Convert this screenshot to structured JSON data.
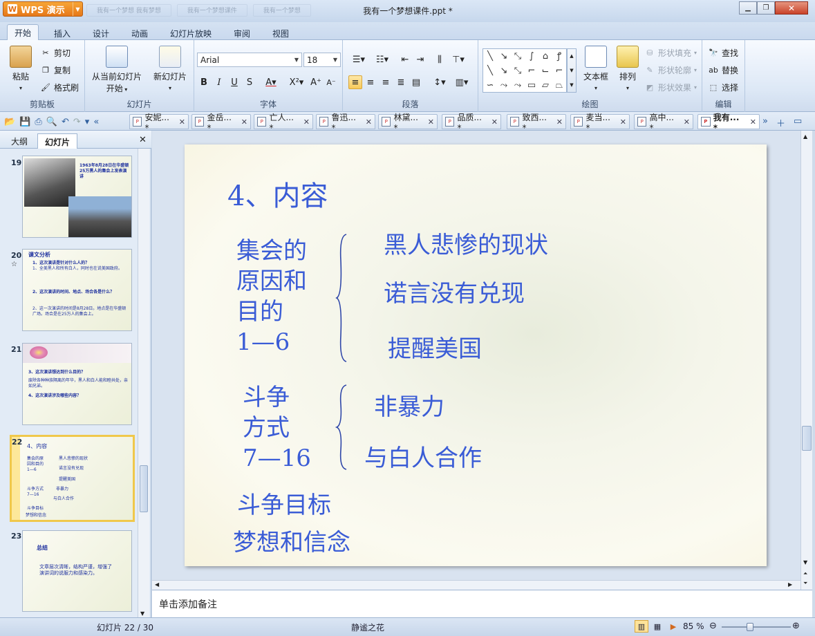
{
  "app": {
    "name": "WPS 演示",
    "window_title": "我有一个梦想课件.ppt *",
    "ghost_tabs": [
      "我有一个梦想 我有梦想",
      "我有一个梦想课件",
      "我有一个梦想"
    ]
  },
  "menu_tabs": [
    "开始",
    "插入",
    "设计",
    "动画",
    "幻灯片放映",
    "审阅",
    "视图"
  ],
  "ribbon": {
    "clipboard": {
      "paste": "粘贴",
      "cut": "剪切",
      "copy": "复制",
      "format_painter": "格式刷",
      "group": "剪贴板"
    },
    "slides": {
      "from_current": "从当前幻灯片",
      "from_current_2": "开始",
      "new_slide": "新幻灯片",
      "group": "幻灯片"
    },
    "font": {
      "name": "Arial",
      "size": "18",
      "group": "字体"
    },
    "paragraph": {
      "group": "段落"
    },
    "drawing": {
      "textbox": "文本框",
      "arrange": "排列",
      "fill": "形状填充",
      "outline": "形状轮廓",
      "effect": "形状效果",
      "group": "绘图"
    },
    "editing": {
      "find": "查找",
      "replace": "替换",
      "select": "选择",
      "group": "编辑"
    }
  },
  "doc_tabs": [
    "安妮... *",
    "金岳... *",
    "亡人... *",
    "鲁迅... *",
    "林黛... *",
    "品质... *",
    "致西... *",
    "麦当... *",
    "高中... *",
    "我有... *"
  ],
  "left_panel": {
    "tabs": [
      "大纲",
      "幻灯片"
    ],
    "slides": [
      {
        "num": "19",
        "lines": [
          "1963年8月28日在华盛",
          "顿25万黑人的集会上",
          "发表演讲"
        ]
      },
      {
        "num": "20",
        "mark": "☆",
        "lines": [
          "课文分析",
          "1、这次演讲是针对什么人的？",
          "1、全美黑人和所有白人，同时也在说美国政府。",
          "2、这次演讲的时间、地点、场合各是什么？",
          "2、这一次演讲的时间是8月28日。地点是在华盛顿广场。场合是在25万人的集会上。"
        ]
      },
      {
        "num": "21",
        "lines": [
          "3、这次演讲想达到什么目的？",
          "废除各种种族隔离的年华，黑人和白人能和睦共处，亲如兄弟。",
          "4、这次演讲涉及哪些内容？"
        ]
      },
      {
        "num": "22",
        "lines": [
          "4、内容",
          "集会的原因和目的1—6",
          "黑人悲惨的现状",
          "诺言没有兑现",
          "提醒美国",
          "斗争方式7—16",
          "非暴力",
          "与白人合作",
          "斗争目标",
          "梦想和信念"
        ]
      },
      {
        "num": "23",
        "lines": [
          "总结",
          "文章层次清晰，结构严谨，增强了演讲词的说服力和感染力。"
        ]
      }
    ]
  },
  "slide": {
    "title": "4、内容",
    "g1_label": [
      "集会的",
      "原因和",
      "目的",
      "1—6"
    ],
    "g1_items": [
      "黑人悲惨的现状",
      "诺言没有兑现",
      "提醒美国"
    ],
    "g2_label": [
      "斗争",
      "方式",
      "7—16"
    ],
    "g2_items": [
      "非暴力",
      "与白人合作"
    ],
    "goal": "斗争目标",
    "belief": "梦想和信念"
  },
  "notes_placeholder": "单击添加备注",
  "status": {
    "slide_info": "幻灯片 22 / 30",
    "theme": "静谧之花",
    "zoom": "85 %",
    "zoom_fraction": 0.85
  }
}
